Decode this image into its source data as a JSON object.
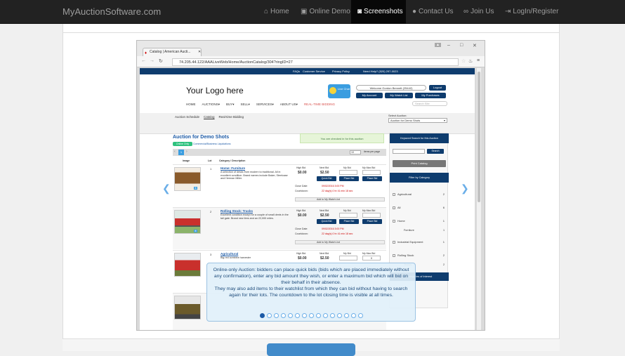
{
  "navbar": {
    "brand": "MyAuctionSoftware.com",
    "items": [
      {
        "label": "Home",
        "icon": "home-icon",
        "glyph": "⌂",
        "active": false
      },
      {
        "label": "Online Demo",
        "icon": "monitor-icon",
        "glyph": "▣",
        "active": false
      },
      {
        "label": "Screenshots",
        "icon": "camera-icon",
        "glyph": "◙",
        "active": true
      },
      {
        "label": "Contact Us",
        "icon": "user-icon",
        "glyph": "●",
        "active": false
      },
      {
        "label": "Join Us",
        "icon": "link-icon",
        "glyph": "∞",
        "active": false
      },
      {
        "label": "LogIn/Register",
        "icon": "login-icon",
        "glyph": "⇥",
        "active": false
      }
    ]
  },
  "browser": {
    "tab_title": "Catalog | American Aucti...",
    "url": "74.205.44.122/AAALiveWeb/Home/AuctionCatalog/304?ringID=27"
  },
  "site": {
    "topbar": {
      "faqs": "FAQs",
      "customer_service": "Customer Service",
      "privacy": "Privacy Policy",
      "help": "Need Help? (520) 297-0023"
    },
    "logo": "Your Logo here",
    "live_chat": "Live Chat",
    "welcome": "Welcome Gordon Bennett (25442)",
    "logout": "Logout",
    "my_account": "My Account",
    "my_watch_list": "My Watch List",
    "my_purchases": "My Purchases",
    "menu": [
      "HOME",
      "AUCTIONS▾",
      "BUY▾",
      "SELL▾",
      "SERVICES▾",
      "ABOUT US▾"
    ],
    "realtime_menu": "REAL-TIME BIDDING",
    "search_placeholder": "Search Site",
    "subnav": [
      "Auction Schedule",
      "Catalog",
      "Real-time Bidding"
    ],
    "select_auction_label": "Select Auction:",
    "select_auction_value": "Auction for Demo Shots",
    "auction_title": "Auction for Demo Shots",
    "online_badge": "Online Only",
    "online_category": "Commercial/Business Liquidations",
    "checked_in": "You are checked in for this auction",
    "pager_page": "1",
    "pager_select": "10",
    "per_page": "items per page",
    "columns": [
      "Image",
      "Lot",
      "Category / Description"
    ],
    "bid_headers": {
      "high": "High Bid",
      "next": "Next Bid",
      "my": "My Bid",
      "max": "My Max Bid"
    },
    "quick_bid": "Quick Bid",
    "place_bid": "Place Bid",
    "close_date_label": "Close Date:",
    "countdown_label": "Countdown:",
    "watch_label": "Add to My Watch List",
    "lots": [
      {
        "no": "1",
        "title": "Home: Furniture",
        "desc": "A selection of desks from modern to traditional. All in excellent condition. Brand names include Baker, Steelcase and Herman Miller.",
        "high": "$0.00",
        "next": "$2.50",
        "close": "09/02/2016 3:00 PM",
        "countdown": "22 day(s) 0 hr 41 min 18 sec"
      },
      {
        "no": "2",
        "title": "Rolling Stock: Trucks",
        "desc": "Excellent condition except for a couple of small dents in the tail gate. Brand new tires and an 22,000 miles.",
        "high": "$0.00",
        "next": "$2.50",
        "close": "09/02/2016 3:00 PM",
        "countdown": "22 day(s) 0 hr 41 min 18 sec"
      },
      {
        "no": "3",
        "title": "Agricultural",
        "desc": "Big red combine harvester",
        "high": "$0.00",
        "next": "$2.50",
        "max": "0"
      }
    ],
    "sidebar": {
      "search_head": "Keyword Search for this Auction",
      "search_btn": "Search",
      "print": "Print Catalog",
      "filter_head": "Filter by Category",
      "categories": [
        {
          "name": "Agricultural",
          "count": "2"
        },
        {
          "name": "All",
          "count": "6"
        },
        {
          "name": "Home",
          "count": "1"
        },
        {
          "name": "Furniture",
          "count": "1",
          "sub": true
        },
        {
          "name": "Industrial Equipment",
          "count": "1"
        },
        {
          "name": "Rolling Stock",
          "count": "2"
        },
        {
          "name": "Trucks",
          "count": "2",
          "sub": true
        }
      ],
      "interest_head": "Categories of Interest"
    }
  },
  "caption": {
    "line1": "Online-only Auction: bidders can place quick bids (bids which are placed immediately without any confirmation), enter any bid amount they wish, or enter a maximum bid which will bid on their behalf in their absence.",
    "line2": "They may also add items to their watchlist from which they can bid without having to search again for their lots. The countdown to the lot closing time is visible at all times."
  },
  "carousel": {
    "slides": 15,
    "active": 0
  },
  "colors": {
    "accent": "#0e3c6e",
    "link": "#1c5aa6",
    "navbar": "#222222"
  }
}
